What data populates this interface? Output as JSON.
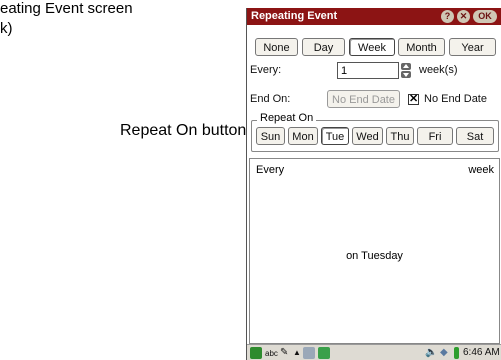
{
  "caption": {
    "line1": "eating Event screen",
    "line2": "k)",
    "callout": "Repeat On buttons"
  },
  "window": {
    "title": "Repeating Event",
    "help_label": "?",
    "close_label": "✕",
    "ok_label": "OK"
  },
  "frequency": {
    "tabs": [
      "None",
      "Day",
      "Week",
      "Month",
      "Year"
    ],
    "selected": "Week"
  },
  "every": {
    "label": "Every:",
    "value": "1",
    "unit": "week(s)"
  },
  "end_on": {
    "label": "End On:",
    "button": "No End Date",
    "checkbox_mark": "✕",
    "checkbox_label": "No End Date",
    "checked": true
  },
  "repeat_on": {
    "label": "Repeat On",
    "days": [
      "Sun",
      "Mon",
      "Tue",
      "Wed",
      "Thu",
      "Fri",
      "Sat"
    ],
    "selected": "Tue"
  },
  "summary": {
    "every": "Every",
    "unit": "week",
    "on": "on Tuesday"
  },
  "statusbar": {
    "keyboard": "abc",
    "time": "6:46 AM"
  },
  "colors": {
    "titlebar": "#8c1414",
    "chrome": "#dedbd3"
  }
}
